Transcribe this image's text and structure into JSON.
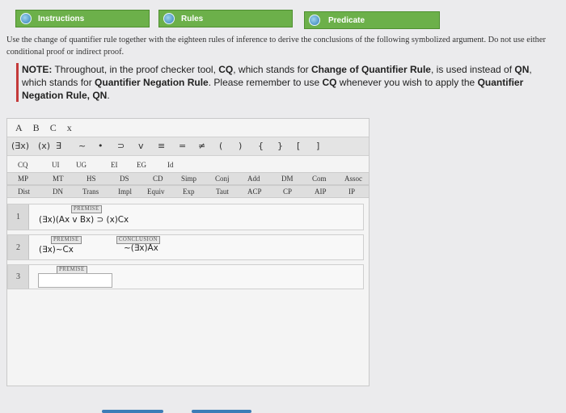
{
  "tabs": [
    {
      "label": "Instructions"
    },
    {
      "label": "Rules"
    },
    {
      "label": "Predicate"
    }
  ],
  "instructions": "Use the change of quantifier rule together with the eighteen rules of inference to derive the conclusions of the following symbolized argument. Do not use either conditional proof or indirect proof.",
  "note": {
    "lead": "NOTE:",
    "t1": " Throughout, in the proof checker tool, ",
    "cq": "CQ",
    "t2": ", which stands for ",
    "cqfull": "Change of Quantifier Rule",
    "t3": ", is used instead of ",
    "qn": "QN",
    "t4": ", which stands for ",
    "qnfull": "Quantifier Negation Rule",
    "t5": ". Please remember to use ",
    "cq2": "CQ",
    "t6": " whenever you wish to apply the ",
    "qnfull2": "Quantifier Negation Rule, QN",
    "t7": "."
  },
  "variables": [
    "A",
    "B",
    "C",
    "x"
  ],
  "symbols": [
    "(∃x)",
    "(x)",
    "∃",
    "~",
    "•",
    "⊃",
    "v",
    "≡",
    "=",
    "≠",
    "(",
    ")",
    "{",
    "}",
    "[",
    "]"
  ],
  "rules": {
    "row1": [
      "CQ",
      "UI",
      "UG",
      "EI",
      "EG",
      "Id"
    ],
    "row2": [
      "MP",
      "MT",
      "HS",
      "DS",
      "CD",
      "Simp",
      "Conj",
      "Add",
      "DM",
      "Com",
      "Assoc"
    ],
    "row3": [
      "Dist",
      "DN",
      "Trans",
      "Impl",
      "Equiv",
      "Exp",
      "Taut",
      "ACP",
      "CP",
      "AIP",
      "IP"
    ]
  },
  "proof": {
    "line1": {
      "num": "1",
      "tag": "PREMISE",
      "formula": "(∃x)(Ax v Bx) ⊃ (x)Cx"
    },
    "line2": {
      "num": "2",
      "tag": "PREMISE",
      "formula": "(∃x)~Cx",
      "ctag": "CONCLUSION",
      "conclusion": "~(∃x)Ax"
    },
    "line3": {
      "num": "3",
      "tag": "PREMISE"
    }
  },
  "colors": {
    "tab_green": "#6cb04a",
    "note_bar": "#c43a3a",
    "accent_blue": "#3d7db7"
  }
}
